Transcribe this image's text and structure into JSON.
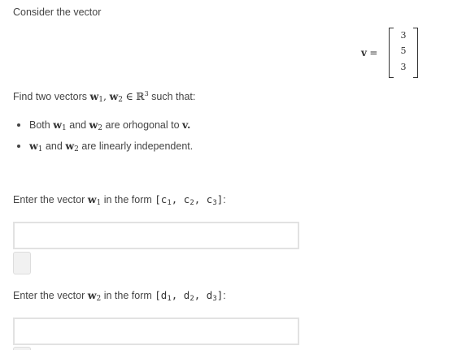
{
  "intro": {
    "text": "Consider the vector"
  },
  "vector": {
    "label": "v",
    "equals": "=",
    "entries": [
      "3",
      "5",
      "3"
    ]
  },
  "prompt": {
    "find_text": "Find two vectors",
    "w1": "w",
    "w1_sub": "1",
    "comma": ",",
    "w2": "w",
    "w2_sub": "2",
    "member_of": "∈",
    "space": "ℝ",
    "space_exp": "3",
    "such_that": "such that:"
  },
  "conditions": [
    {
      "prefix": "Both",
      "w1": "w",
      "w1_sub": "1",
      "and": "and",
      "w2": "w",
      "w2_sub": "2",
      "suffix": "are orhogonal to",
      "target": "v."
    },
    {
      "w1": "w",
      "w1_sub": "1",
      "and": "and",
      "w2": "w",
      "w2_sub": "2",
      "suffix": "are linearly independent."
    }
  ],
  "answer1": {
    "label_prefix": "Enter the vector",
    "vec": "w",
    "vec_sub": "1",
    "label_mid": "in the form",
    "form": "[c",
    "c1_sub": "1",
    "sep1": ", c",
    "c2_sub": "2",
    "sep2": ", c",
    "c3_sub": "3",
    "close": "]",
    "colon": ":",
    "value": "",
    "placeholder": ""
  },
  "answer2": {
    "label_prefix": "Enter the vector",
    "vec": "w",
    "vec_sub": "2",
    "label_mid": "in the form",
    "form": "[d",
    "d1_sub": "1",
    "sep1": ", d",
    "d2_sub": "2",
    "sep2": ", d",
    "d3_sub": "3",
    "close": "]",
    "colon": ":",
    "value": "",
    "placeholder": ""
  }
}
